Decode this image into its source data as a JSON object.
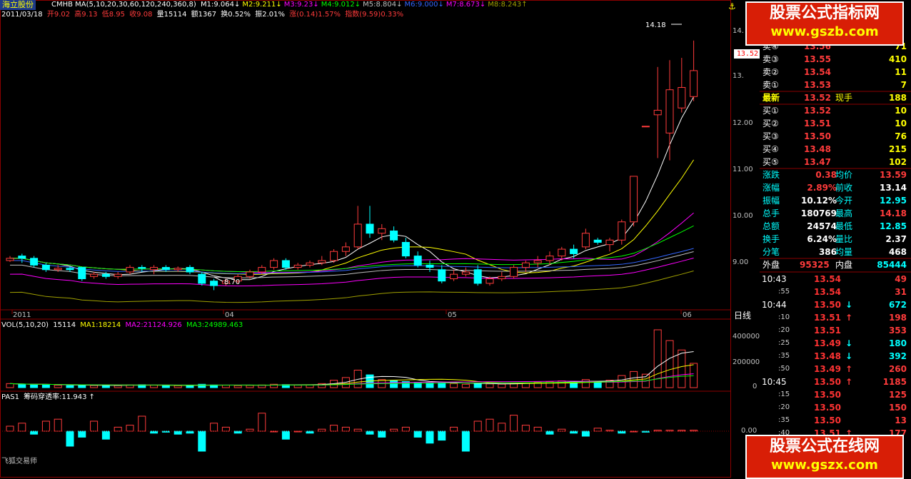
{
  "stock_name": "海立股份",
  "header": {
    "formula": "CMHB MA(5,10,20,30,60,120,240,360,8)",
    "m_values": [
      "M1:9.064",
      "M2:9.211",
      "M3:9.23",
      "M4:9.012",
      "M5:8.804",
      "M6:9.000",
      "M7:8.673",
      "M8:8.243"
    ],
    "m_colors": [
      "#ffffff",
      "#ffff00",
      "#ff00ff",
      "#00ff00",
      "#c0c0c0",
      "#3366ff",
      "#ff00ff",
      "#a0a000"
    ],
    "m_arrows": [
      "↓",
      "↓",
      "↓",
      "↓",
      "↓",
      "↓",
      "↓",
      "↑"
    ],
    "date": "2011/03/18",
    "open": "开9.02",
    "high": "高9.13",
    "low": "低8.95",
    "close": "收9.08",
    "volume": "量15114",
    "amount": "额1367",
    "turnover": "换0.52%",
    "amplitude": "振2.01%",
    "change": "涨(0.14)1.57%",
    "index": "指数(9.59)0.33%"
  },
  "price_axis": {
    "ticks": [
      "14.",
      "13.",
      "12.00",
      "11.00",
      "10.00",
      "9.00"
    ],
    "current_tag": "13.52",
    "max_label": "14.18",
    "min_label": "8.70"
  },
  "date_axis": {
    "labels": [
      "2011",
      "04",
      "05",
      "06"
    ],
    "period": "日线"
  },
  "volume_panel": {
    "title": "VOL(5,10,20)",
    "vol": "15114",
    "ma1": "MA1:18214",
    "ma2": "MA2:21124.926",
    "ma3": "MA3:24989.463",
    "ticks": [
      "400000",
      "200000",
      "0"
    ]
  },
  "indicator_panel": {
    "title": "PAS1",
    "label": "筹码穿透率:11.943",
    "arrow": "↑",
    "zero_tick": "0.00"
  },
  "software_label": "飞狐交易师",
  "watermark_top": {
    "title": "股票公式指标网",
    "url": "www.gszb.com"
  },
  "watermark_bottom": {
    "title": "股票公式在线网",
    "url": "www.gszx.com"
  },
  "order_book": {
    "sell": [
      {
        "label": "卖④",
        "price": "13.56",
        "vol": "71"
      },
      {
        "label": "卖③",
        "price": "13.55",
        "vol": "410"
      },
      {
        "label": "卖②",
        "price": "13.54",
        "vol": "11"
      },
      {
        "label": "卖①",
        "price": "13.53",
        "vol": "7"
      }
    ],
    "latest": {
      "label": "最新",
      "price": "13.52",
      "label2": "现手",
      "vol": "188"
    },
    "buy": [
      {
        "label": "买①",
        "price": "13.52",
        "vol": "10"
      },
      {
        "label": "买②",
        "price": "13.51",
        "vol": "10"
      },
      {
        "label": "买③",
        "price": "13.50",
        "vol": "76"
      },
      {
        "label": "买④",
        "price": "13.48",
        "vol": "215"
      },
      {
        "label": "买⑤",
        "price": "13.47",
        "vol": "102"
      }
    ]
  },
  "stats": [
    {
      "l1": "涨跌",
      "v1": "0.38",
      "l2": "均价",
      "v2": "13.59"
    },
    {
      "l1": "涨幅",
      "v1": "2.89%",
      "l2": "前收",
      "v2": "13.14"
    },
    {
      "l1": "振幅",
      "v1": "10.12%",
      "l2": "今开",
      "v2": "12.95"
    },
    {
      "l1": "总手",
      "v1": "180769",
      "l2": "最高",
      "v2": "14.18"
    },
    {
      "l1": "总额",
      "v1": "24574",
      "l2": "最低",
      "v2": "12.85"
    },
    {
      "l1": "换手",
      "v1": "6.24%",
      "l2": "量比",
      "v2": "2.37"
    },
    {
      "l1": "分笔",
      "v1": "386",
      "l2": "均量",
      "v2": "468"
    }
  ],
  "outer_inner": {
    "l1": "外盘",
    "v1": "95325",
    "l2": "内盘",
    "v2": "85444"
  },
  "ticks_list": [
    {
      "time": "10:43",
      "sub": false,
      "price": "13.54",
      "arrow": "",
      "vol": "49"
    },
    {
      "time": ":55",
      "sub": true,
      "price": "13.54",
      "arrow": "",
      "vol": "31"
    },
    {
      "time": "10:44",
      "sub": false,
      "price": "13.50",
      "arrow": "↓",
      "vol": "672"
    },
    {
      "time": ":10",
      "sub": true,
      "price": "13.51",
      "arrow": "↑",
      "vol": "198"
    },
    {
      "time": ":20",
      "sub": true,
      "price": "13.51",
      "arrow": "",
      "vol": "353"
    },
    {
      "time": ":25",
      "sub": true,
      "price": "13.49",
      "arrow": "↓",
      "vol": "180"
    },
    {
      "time": ":35",
      "sub": true,
      "price": "13.48",
      "arrow": "↓",
      "vol": "392"
    },
    {
      "time": ":50",
      "sub": true,
      "price": "13.49",
      "arrow": "↑",
      "vol": "260"
    },
    {
      "time": "10:45",
      "sub": false,
      "price": "13.50",
      "arrow": "↑",
      "vol": "1185"
    },
    {
      "time": ":15",
      "sub": true,
      "price": "13.50",
      "arrow": "",
      "vol": "125"
    },
    {
      "time": ":20",
      "sub": true,
      "price": "13.50",
      "arrow": "",
      "vol": "150"
    },
    {
      "time": ":35",
      "sub": true,
      "price": "13.50",
      "arrow": "",
      "vol": "13"
    },
    {
      "time": ":40",
      "sub": true,
      "price": "13.51",
      "arrow": "↑",
      "vol": "177"
    }
  ],
  "colors": {
    "up": "#ff3b3b",
    "down": "#00ffff",
    "grid": "#8b0000"
  },
  "chart_data": {
    "type": "candlestick",
    "ylim": [
      8.3,
      14.6
    ],
    "candles": [
      [
        9.35,
        9.4,
        9.32,
        9.45
      ],
      [
        9.45,
        9.4,
        9.3,
        9.5
      ],
      [
        9.4,
        9.25,
        9.2,
        9.45
      ],
      [
        9.25,
        9.15,
        9.1,
        9.3
      ],
      [
        9.15,
        9.18,
        9.1,
        9.25
      ],
      [
        9.18,
        9.15,
        9.1,
        9.22
      ],
      [
        9.2,
        8.95,
        8.9,
        9.2
      ],
      [
        9.0,
        9.05,
        8.95,
        9.1
      ],
      [
        9.05,
        9.0,
        8.95,
        9.1
      ],
      [
        9.0,
        9.05,
        8.95,
        9.1
      ],
      [
        9.1,
        9.2,
        9.05,
        9.25
      ],
      [
        9.2,
        9.18,
        9.1,
        9.25
      ],
      [
        9.15,
        9.2,
        9.05,
        9.25
      ],
      [
        9.2,
        9.15,
        9.1,
        9.25
      ],
      [
        9.15,
        9.18,
        9.1,
        9.22
      ],
      [
        9.2,
        9.1,
        9.05,
        9.25
      ],
      [
        9.05,
        8.85,
        8.8,
        9.1
      ],
      [
        8.9,
        8.8,
        8.7,
        8.95
      ],
      [
        8.85,
        8.9,
        8.8,
        8.95
      ],
      [
        8.9,
        9.0,
        8.85,
        9.05
      ],
      [
        9.0,
        9.1,
        8.95,
        9.15
      ],
      [
        9.1,
        9.2,
        9.05,
        9.25
      ],
      [
        9.2,
        9.35,
        9.15,
        9.4
      ],
      [
        9.35,
        9.2,
        9.15,
        9.4
      ],
      [
        9.2,
        9.25,
        9.15,
        9.3
      ],
      [
        9.25,
        9.3,
        9.2,
        9.35
      ],
      [
        9.3,
        9.35,
        9.25,
        9.45
      ],
      [
        9.35,
        9.55,
        9.3,
        9.6
      ],
      [
        9.55,
        9.65,
        9.45,
        9.75
      ],
      [
        9.65,
        10.15,
        9.6,
        10.55
      ],
      [
        10.15,
        9.95,
        9.85,
        10.55
      ],
      [
        9.95,
        10.05,
        9.8,
        10.15
      ],
      [
        10.0,
        9.8,
        9.75,
        10.1
      ],
      [
        9.75,
        9.45,
        9.4,
        9.85
      ],
      [
        9.45,
        9.25,
        9.2,
        9.55
      ],
      [
        9.25,
        9.2,
        9.1,
        9.35
      ],
      [
        9.15,
        8.9,
        8.85,
        9.25
      ],
      [
        8.95,
        9.05,
        8.9,
        9.15
      ],
      [
        9.05,
        9.1,
        9.0,
        9.2
      ],
      [
        9.15,
        8.85,
        8.8,
        9.25
      ],
      [
        8.85,
        8.95,
        8.8,
        9.0
      ],
      [
        8.95,
        9.0,
        8.9,
        9.1
      ],
      [
        9.0,
        9.2,
        8.95,
        9.25
      ],
      [
        9.2,
        9.3,
        9.1,
        9.35
      ],
      [
        9.3,
        9.35,
        9.2,
        9.45
      ],
      [
        9.35,
        9.45,
        9.25,
        9.55
      ],
      [
        9.45,
        9.6,
        9.35,
        9.65
      ],
      [
        9.6,
        9.5,
        9.4,
        9.7
      ],
      [
        9.65,
        9.95,
        9.6,
        10.05
      ],
      [
        9.8,
        9.75,
        9.7,
        9.85
      ],
      [
        9.7,
        9.8,
        9.55,
        9.85
      ],
      [
        9.8,
        10.2,
        9.7,
        10.25
      ],
      [
        10.2,
        11.2,
        10.1,
        11.2
      ],
      [
        12.3,
        12.3,
        12.3,
        12.3
      ],
      [
        12.55,
        12.65,
        11.6,
        13.6
      ],
      [
        12.15,
        13.1,
        11.55,
        13.75
      ],
      [
        12.7,
        13.15,
        12.6,
        13.8
      ],
      [
        12.95,
        13.52,
        12.85,
        14.18
      ]
    ],
    "volume": [
      30000,
      25000,
      20000,
      22000,
      18000,
      15000,
      20000,
      16000,
      18000,
      15000,
      20000,
      22000,
      18000,
      16000,
      15000,
      14000,
      25000,
      20000,
      18000,
      15000,
      17000,
      20000,
      25000,
      22000,
      18000,
      20000,
      30000,
      55000,
      75000,
      130000,
      95000,
      60000,
      50000,
      45000,
      40000,
      35000,
      38000,
      30000,
      25000,
      32000,
      28000,
      26000,
      30000,
      35000,
      40000,
      45000,
      50000,
      42000,
      60000,
      40000,
      55000,
      90000,
      120000,
      100000,
      430000,
      350000,
      280000,
      180769
    ],
    "ma_lines": [
      {
        "name": "M1",
        "color": "#ffffff"
      },
      {
        "name": "M2",
        "color": "#ffff00"
      },
      {
        "name": "M3",
        "color": "#ff00ff"
      },
      {
        "name": "M4",
        "color": "#00ff00"
      },
      {
        "name": "M5",
        "color": "#c0c0c0"
      },
      {
        "name": "M6",
        "color": "#3366ff"
      },
      {
        "name": "M7",
        "color": "#ff00ff"
      },
      {
        "name": "M8",
        "color": "#a0a000"
      }
    ],
    "pas": [
      5,
      8,
      -3,
      10,
      12,
      -15,
      -6,
      10,
      -8,
      4,
      6,
      15,
      -2,
      -1,
      -3,
      -2,
      -20,
      8,
      4,
      -2,
      2,
      18,
      0,
      -8,
      0,
      -2,
      2,
      6,
      4,
      2,
      -3,
      -6,
      2,
      4,
      -6,
      -12,
      -9,
      4,
      -20,
      10,
      12,
      8,
      16,
      6,
      4,
      -3,
      2,
      -2,
      -5,
      3,
      1,
      -2,
      0,
      -1,
      1,
      1,
      1,
      1
    ]
  }
}
